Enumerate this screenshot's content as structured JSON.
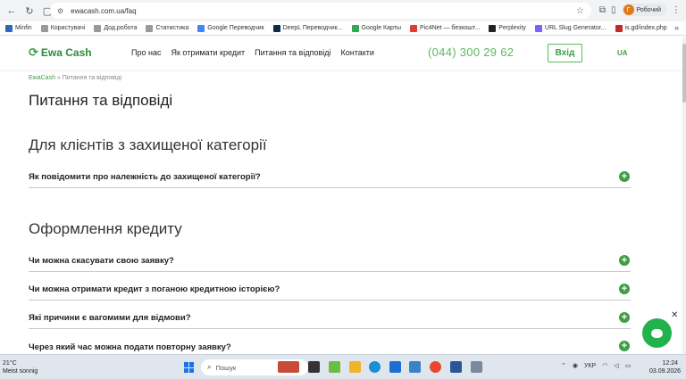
{
  "browser": {
    "url": "ewacash.com.ua/faq",
    "profile_initial": "Г",
    "profile_label": "Робочий",
    "bookmarks": [
      {
        "label": "Minfin",
        "color": "#2b6cb0"
      },
      {
        "label": "Користувачі",
        "color": "#999999"
      },
      {
        "label": "Дод.робота",
        "color": "#999999"
      },
      {
        "label": "Статистика",
        "color": "#999999"
      },
      {
        "label": "Google Переводчик",
        "color": "#4285f4"
      },
      {
        "label": "DeepL Переводчик...",
        "color": "#0f2b46"
      },
      {
        "label": "Google Карты",
        "color": "#34a853"
      },
      {
        "label": "Pic4Net — безкошт...",
        "color": "#e53935"
      },
      {
        "label": "Perplexity",
        "color": "#222222"
      },
      {
        "label": "URL Slug Generator...",
        "color": "#7b61ff"
      },
      {
        "label": "is.gd/index.php",
        "color": "#c62828"
      }
    ]
  },
  "site": {
    "logo": "Ewa Cash",
    "nav": [
      "Про нас",
      "Як отримати кредит",
      "Питання та відповіді",
      "Контакти"
    ],
    "phone": "(044) 300 29 62",
    "login": "Вхід",
    "lang": "UA",
    "accent": "#3e9e46"
  },
  "breadcrumb": {
    "home": "EwaCash",
    "separator": "»",
    "current": "Питання та відповіді"
  },
  "page_title": "Питання та відповіді",
  "sections": [
    {
      "title": "Для клієнтів з захищеної категорії",
      "questions": [
        "Як повідомити про належність до захищеної категорії?"
      ]
    },
    {
      "title": "Оформлення кредиту",
      "questions": [
        "Чи можна скасувати свою заявку?",
        "Чи можна отримати кредит з поганою кредитною історією?",
        "Які причини є вагомими для відмови?",
        "Через який час можна подати повторну заявку?"
      ]
    }
  ],
  "taskbar": {
    "temperature": "21°C",
    "weather": "Meist sonnig",
    "search_placeholder": "Пошук",
    "lang": "УКР",
    "time": "12:24",
    "date": "03.09.2026"
  }
}
